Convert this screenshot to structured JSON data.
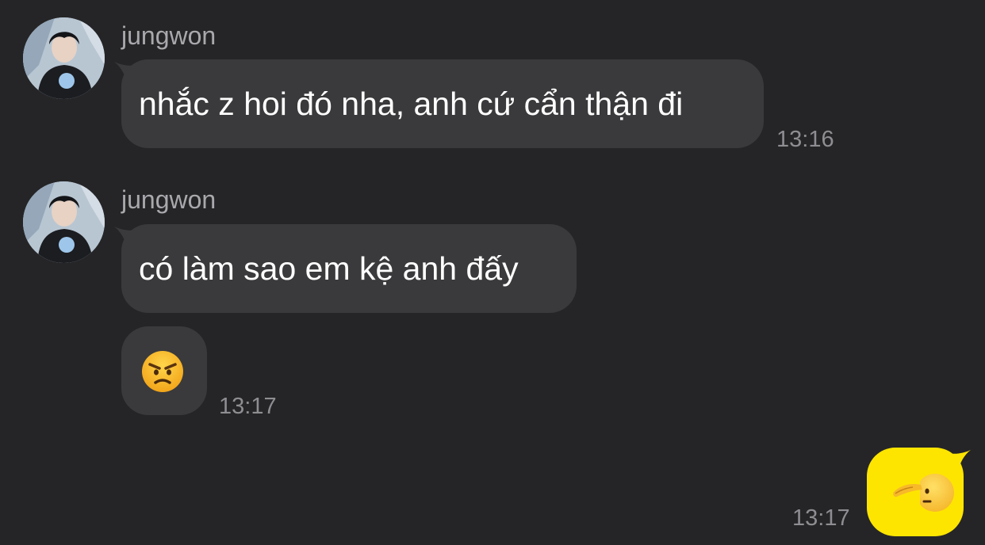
{
  "colors": {
    "background": "#252527",
    "incoming_bubble": "#3a3a3c",
    "outgoing_bubble": "#fee500",
    "sender_name": "#a9a9ad",
    "timestamp": "#8e8e92"
  },
  "messages": [
    {
      "direction": "incoming",
      "sender": "jungwon",
      "text": "nhắc z hoi đó nha, anh cứ cẩn thận đi",
      "time": "13:16",
      "avatar_icon": "profile-photo"
    },
    {
      "direction": "incoming",
      "sender": "jungwon",
      "text": "có làm sao em kệ anh đấy",
      "time": "",
      "avatar_icon": "profile-photo"
    },
    {
      "direction": "incoming",
      "emoji_icon": "angry-face-emoji",
      "time": "13:17"
    },
    {
      "direction": "outgoing",
      "emoji_icon": "saluting-face-emoji",
      "time": "13:17"
    }
  ]
}
